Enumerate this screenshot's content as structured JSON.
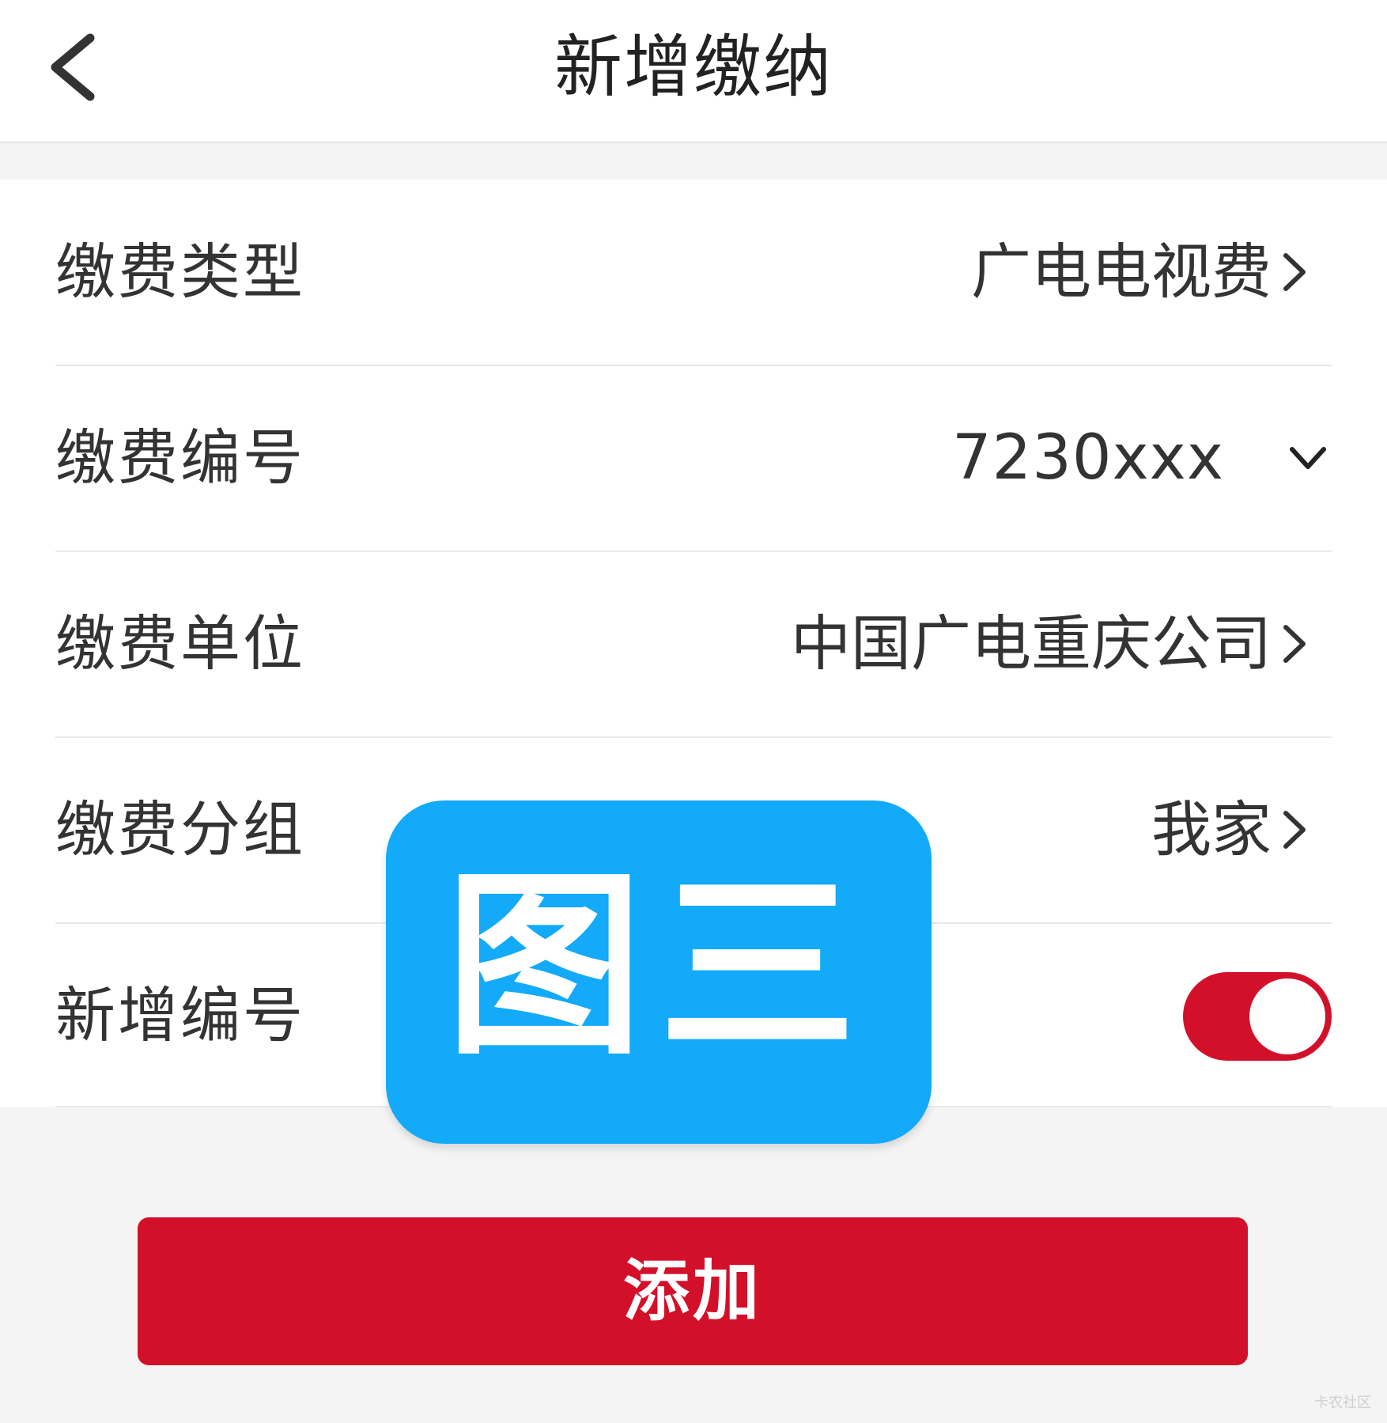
{
  "navbar": {
    "title": "新增缴纳",
    "back_icon": "chevron-left-icon"
  },
  "form": {
    "rows": [
      {
        "label": "缴费类型",
        "value": "广电电视费",
        "icon": "chevron-right-icon"
      },
      {
        "label": "缴费编号",
        "value": "7230xxx",
        "icon": "chevron-down-icon"
      },
      {
        "label": "缴费单位",
        "value": "中国广电重庆公司",
        "icon": "chevron-right-icon"
      },
      {
        "label": "缴费分组",
        "value": "我家",
        "icon": "chevron-right-icon"
      },
      {
        "label": "新增编号",
        "toggle_on": true
      }
    ]
  },
  "actions": {
    "add_label": "添加"
  },
  "overlay": {
    "badge_text": "图三"
  },
  "watermark": "卡农社区",
  "colors": {
    "accent": "#d3102a",
    "badge": "#12aaf9",
    "background": "#f4f4f4"
  }
}
